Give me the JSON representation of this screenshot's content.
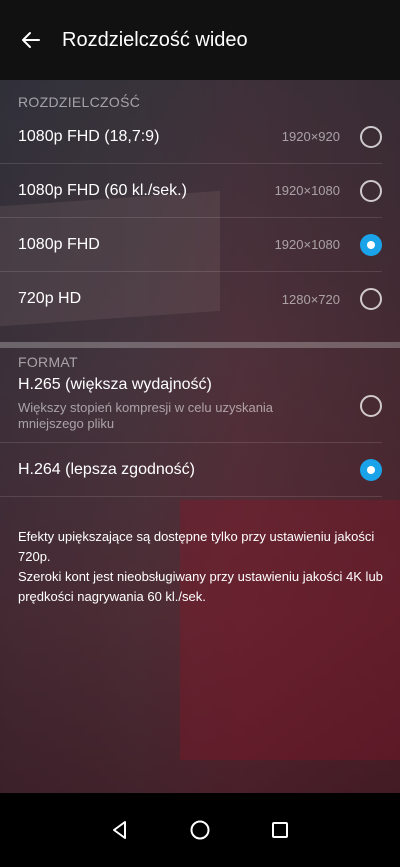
{
  "header": {
    "title": "Rozdzielczość wideo"
  },
  "resolution": {
    "section_label": "ROZDZIELCZOŚĆ",
    "options": [
      {
        "label": "1080p FHD (18,7:9)",
        "resolution": "1920×920",
        "selected": false
      },
      {
        "label": "1080p FHD (60 kl./sek.)",
        "resolution": "1920×1080",
        "selected": false
      },
      {
        "label": "1080p FHD",
        "resolution": "1920×1080",
        "selected": true
      },
      {
        "label": "720p HD",
        "resolution": "1280×720",
        "selected": false
      }
    ]
  },
  "format": {
    "section_label": "FORMAT",
    "options": [
      {
        "label": "H.265 (większa wydajność)",
        "description": "Większy stopień kompresji w celu uzyskania mniejszego pliku",
        "selected": false
      },
      {
        "label": "H.264 (lepsza zgodność)",
        "description": "",
        "selected": true
      }
    ]
  },
  "notes": {
    "line1": "Efekty upiększające są dostępne tylko przy ustawieniu jakości 720p.",
    "line2": "Szeroki kont jest nieobsługiwany przy ustawieniu jakości 4K lub prędkości nagrywania 60 kl./sek."
  },
  "colors": {
    "accent": "#1aa3e8",
    "topbar": "#111111",
    "navbar": "#000000"
  },
  "icons": {
    "back": "arrow-left-icon",
    "nav_back": "triangle-back-icon",
    "nav_home": "circle-home-icon",
    "nav_recents": "square-recents-icon"
  }
}
